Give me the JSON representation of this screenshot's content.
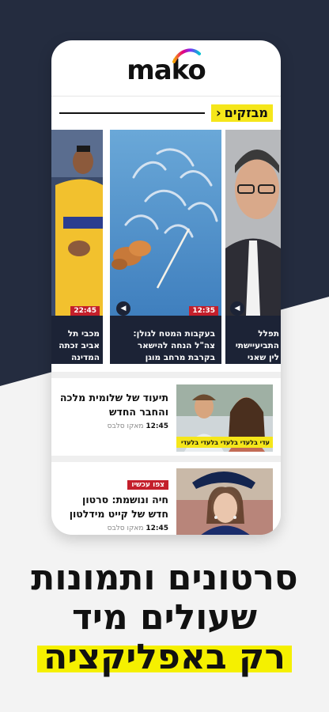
{
  "app": {
    "logo_text": "mako"
  },
  "section": {
    "title": "מבזקים"
  },
  "carousel": [
    {
      "time": "22:45",
      "caption": "מכבי תל אביב זכתה המדינה",
      "has_play": false
    },
    {
      "time": "12:35",
      "caption": "בעקבות המטח לגולן: צה\"ל הנחה להישאר בקרבת מרחב מוגן",
      "has_play": true
    },
    {
      "time": "",
      "caption": "תפלל התביעיישתי לין שאני מתפל",
      "has_play": true
    }
  ],
  "news": [
    {
      "title": "תיעוד של שלומית מלכה והחבר החדש",
      "time": "12:45",
      "source": "מאקו סלבס",
      "tag": "",
      "thumb_label": "עדי בלעדי בלעדי בלעדי בלעדי"
    },
    {
      "title": "חיה ונושמת: סרטון חדש של קייט מידלטון",
      "time": "12:45",
      "source": "מאקו סלבס",
      "tag": "צפו עכשיו",
      "thumb_label": ""
    }
  ],
  "promo": {
    "line1": "סרטונים ותמונות",
    "line2": "שעולים מיד",
    "line3": "רק באפליקציה"
  },
  "colors": {
    "accent_yellow": "#f5e61a",
    "badge_red": "#c41f2b",
    "navy": "#242c3f"
  }
}
